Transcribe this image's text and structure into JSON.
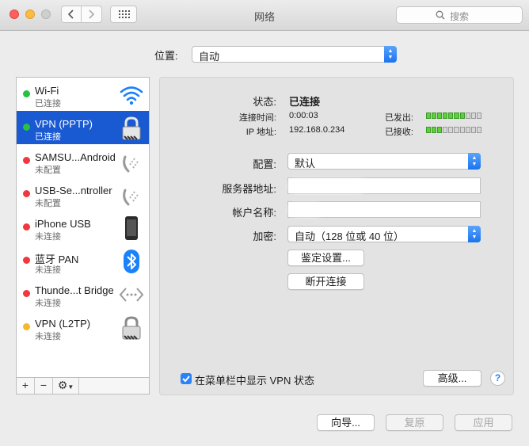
{
  "window": {
    "title": "网络"
  },
  "toolbar": {
    "search_placeholder": "搜索"
  },
  "location": {
    "label": "位置:",
    "value": "自动"
  },
  "sidebar": {
    "items": [
      {
        "name": "Wi-Fi",
        "status": "已连接",
        "dot_color": "#29c23e",
        "icon": "wifi-icon"
      },
      {
        "name": "VPN (PPTP)",
        "status": "已连接",
        "dot_color": "#29c23e",
        "icon": "lock-icon"
      },
      {
        "name": "SAMSU...Android",
        "status": "未配置",
        "dot_color": "#f0383e",
        "icon": "phone-dock-icon"
      },
      {
        "name": "USB-Se...ntroller",
        "status": "未配置",
        "dot_color": "#f0383e",
        "icon": "phone-dock-icon"
      },
      {
        "name": "iPhone USB",
        "status": "未连接",
        "dot_color": "#f0383e",
        "icon": "iphone-icon"
      },
      {
        "name": "蓝牙 PAN",
        "status": "未连接",
        "dot_color": "#f0383e",
        "icon": "bluetooth-icon"
      },
      {
        "name": "Thunde...t Bridge",
        "status": "未连接",
        "dot_color": "#f0383e",
        "icon": "thunderbolt-bridge-icon"
      },
      {
        "name": "VPN (L2TP)",
        "status": "未连接",
        "dot_color": "#f7b62c",
        "icon": "lock-icon"
      }
    ],
    "footer": {
      "add": "+",
      "remove": "−",
      "gear": "⚙"
    }
  },
  "status": {
    "label": "状态:",
    "value": "已连接",
    "time_label": "连接时间:",
    "time_value": "0:00:03",
    "ip_label": "IP 地址:",
    "ip_value": "192.168.0.234",
    "sent_label": "已发出:",
    "received_label": "已接收:",
    "sent_level": 0.7,
    "received_level": 0.3
  },
  "form": {
    "config_label": "配置:",
    "config_value": "默认",
    "server_label": "服务器地址:",
    "account_label": "帐户名称:",
    "encryption_label": "加密:",
    "encryption_value": "自动（128 位或 40 位）",
    "auth_button": "鉴定设置...",
    "disconnect_button": "断开连接"
  },
  "show_vpn_status": {
    "label": "在菜单栏中显示 VPN 状态",
    "checked": true
  },
  "buttons": {
    "advanced": "高级...",
    "help": "?",
    "assist": "向导...",
    "revert": "复原",
    "apply": "应用"
  },
  "colors": {
    "accent": "#1959d1",
    "popup_accent": "#2a82f6"
  }
}
